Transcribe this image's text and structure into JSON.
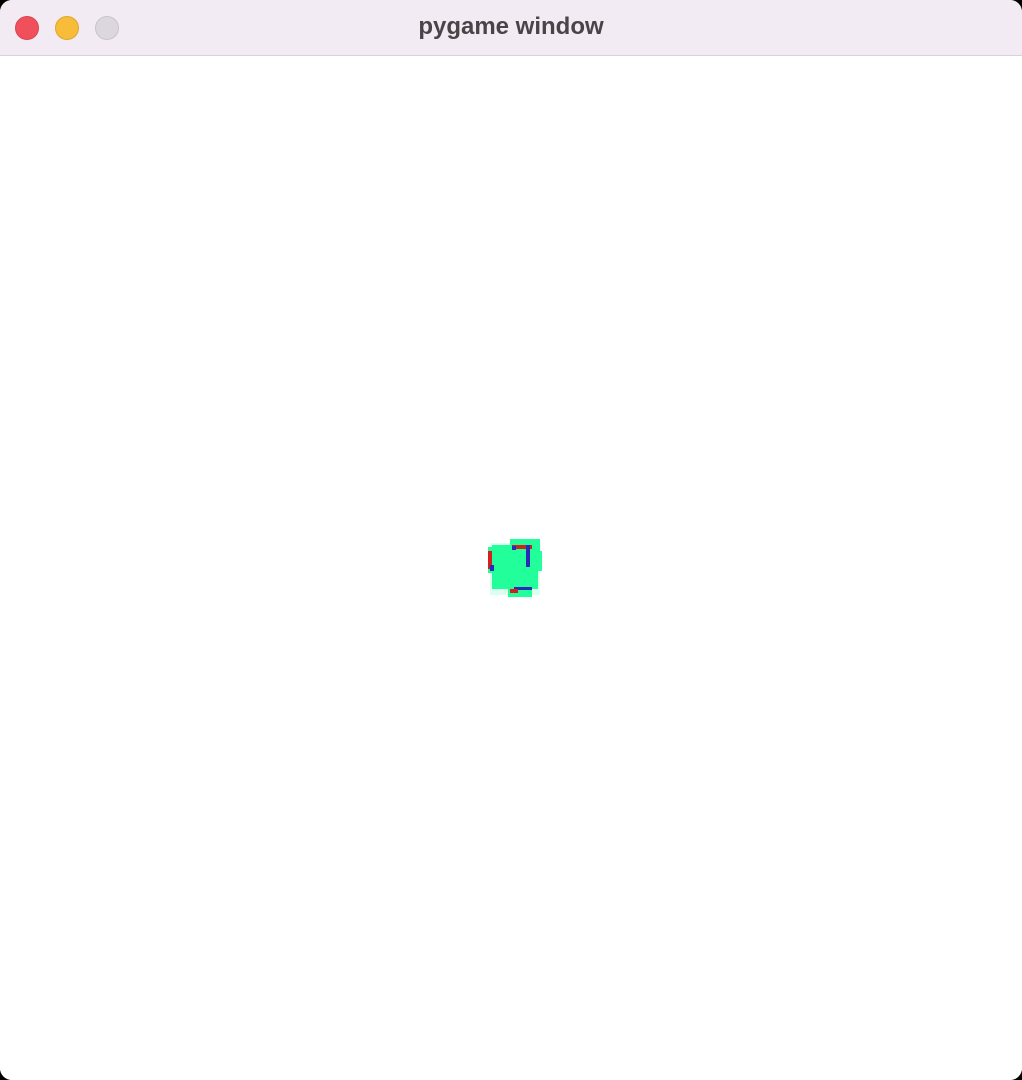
{
  "window": {
    "title": "pygame window"
  },
  "controls": {
    "close": "close-button",
    "minimize": "minimize-button",
    "zoom": "zoom-button"
  },
  "colors": {
    "titlebar": "#f3ebf3",
    "canvas_background": "#ffffff",
    "sprite_body": "#22ff9a",
    "sprite_edge_red": "#d2201f",
    "sprite_edge_blue": "#2a2ab8"
  },
  "icons": {
    "sprite": "green-blob-sprite"
  }
}
